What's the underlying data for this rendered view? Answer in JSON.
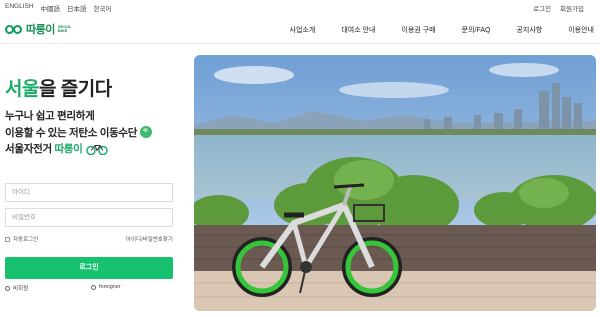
{
  "topbar": {
    "languages": [
      "ENGLISH",
      "中國語",
      "日本語",
      "한국어"
    ],
    "login": "로그인",
    "signup": "회원가입"
  },
  "logo": {
    "name": "따릉이",
    "sub_line1": "SEOUL",
    "sub_line2": "BIKE"
  },
  "nav": [
    "사업소개",
    "대여소 안내",
    "이용권 구매",
    "문의/FAQ",
    "공지사항",
    "이용안내"
  ],
  "hero": {
    "slogan_highlight": "서울",
    "slogan_rest": "을 즐기다",
    "line1": "누구나 쉽고 편리하게",
    "line2": "이용할 수 있는 저탄소 이동수단",
    "line3": "서울자전거",
    "brand": "따릉이"
  },
  "form": {
    "id_placeholder": "아이디",
    "pw_placeholder": "비밀번호",
    "remember": "자동로그인",
    "find": "아이디/비밀번호찾기",
    "login_button": "로그인",
    "non_member": "비회원",
    "foreigner": "foreigner"
  },
  "colors": {
    "brand_green": "#17c16f",
    "logo_green": "#0c9b5a"
  }
}
